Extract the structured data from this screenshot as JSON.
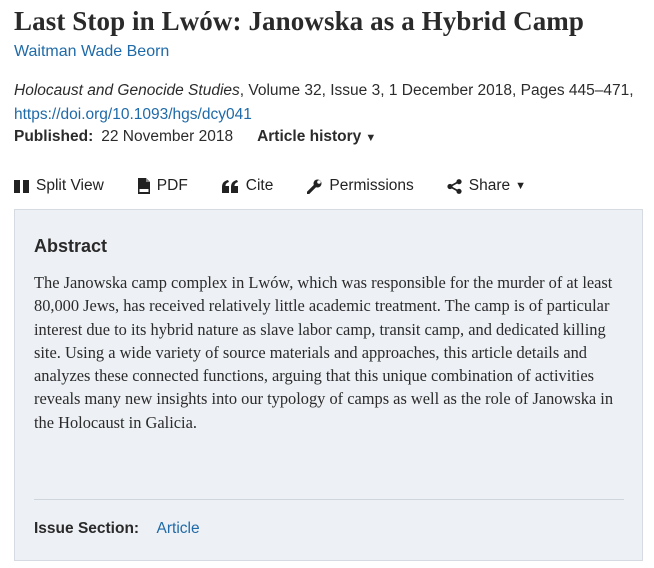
{
  "article": {
    "title": "Last Stop in Lwów: Janowska as a Hybrid Camp",
    "author": "Waitman Wade Beorn",
    "journal": "Holocaust and Genocide Studies",
    "citation_rest": ", Volume 32, Issue 3, 1 December 2018, Pages 445–471,",
    "doi": "https://doi.org/10.1093/hgs/dcy041",
    "published_label": "Published:",
    "published_date": "22 November 2018",
    "history_label": "Article history"
  },
  "toolbar": {
    "split_view": "Split View",
    "pdf": "PDF",
    "cite": "Cite",
    "permissions": "Permissions",
    "share": "Share",
    "icons": [
      "split-view-icon",
      "pdf-icon",
      "quote-icon",
      "wrench-icon",
      "share-icon",
      "caret-down-icon"
    ]
  },
  "abstract": {
    "heading": "Abstract",
    "body": "The Janowska camp complex in Lwów, which was responsible for the murder of at least 80,000 Jews, has received relatively little academic treatment. The camp is of particular interest due to its hybrid nature as slave labor camp, transit camp, and dedicated killing site. Using a wide variety of source materials and approaches, this article details and analyzes these connected functions, arguing that this unique combination of activities reveals many new insights into our typology of camps as well as the role of Janowska in the Holocaust in Galicia.",
    "issue_section_label": "Issue Section:",
    "issue_section_value": "Article"
  },
  "colors": {
    "link": "#1f6aa8",
    "abstract_bg": "#edf0f4",
    "text": "#2b2b2b"
  }
}
